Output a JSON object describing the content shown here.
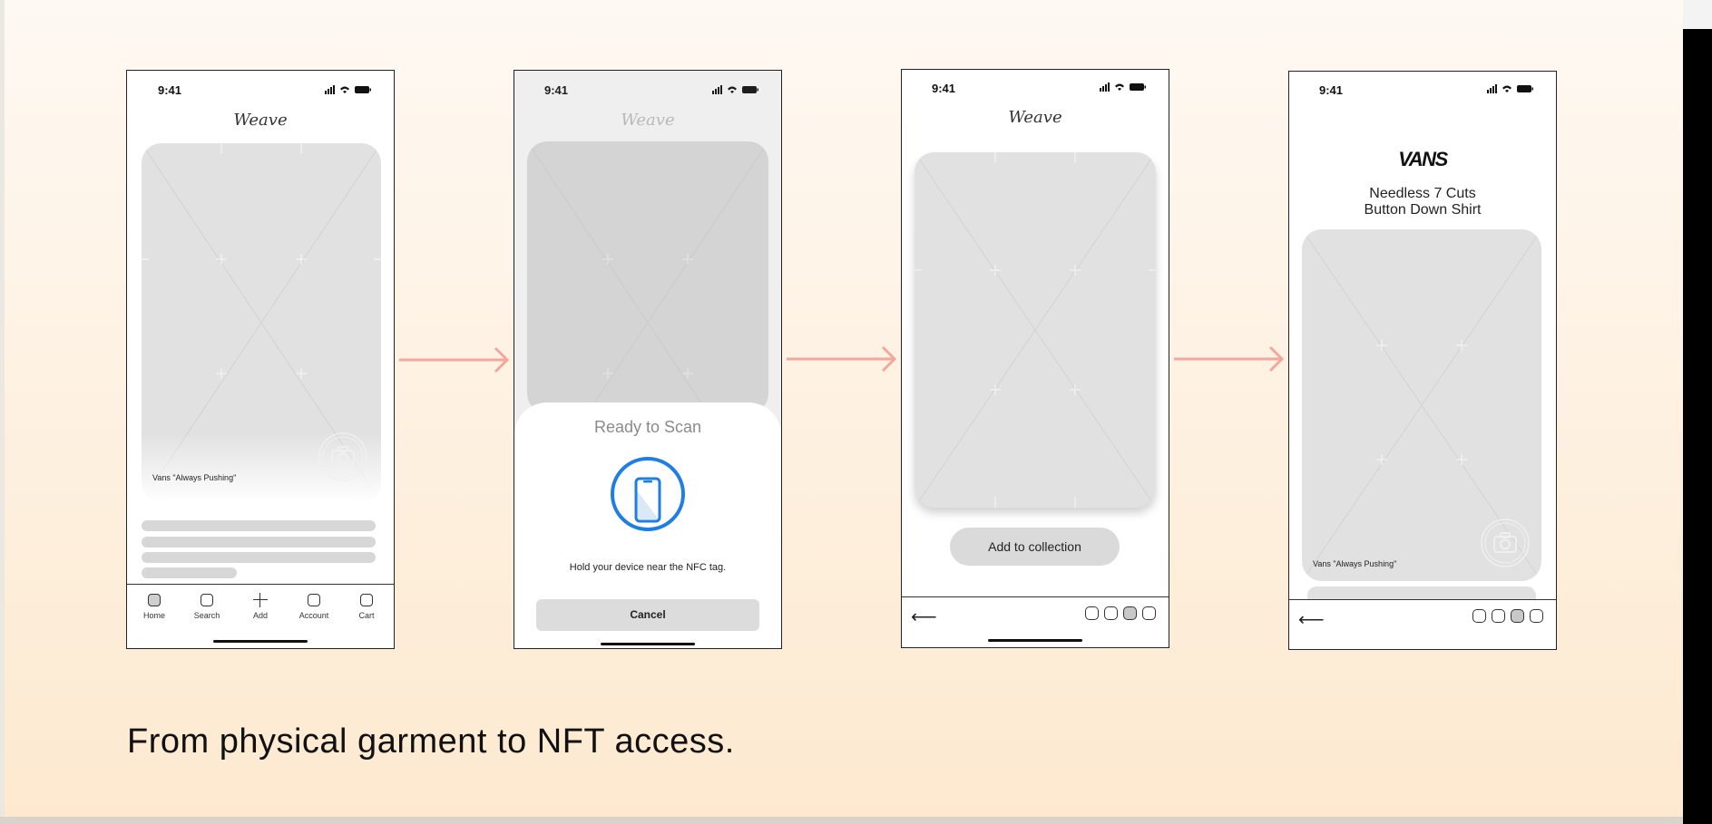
{
  "status_time": "9:41",
  "brand": "Weave",
  "screen1": {
    "card_caption": "Vans \"Always Pushing\"",
    "tabs": [
      {
        "label": "Home"
      },
      {
        "label": "Search"
      },
      {
        "label": "Add"
      },
      {
        "label": "Account"
      },
      {
        "label": "Cart"
      }
    ]
  },
  "screen2": {
    "sheet_title": "Ready to Scan",
    "message": "Hold your device near the NFC tag.",
    "cancel_label": "Cancel"
  },
  "screen3": {
    "add_label": "Add to collection",
    "back_icon": "⟵",
    "active_step": 3
  },
  "screen4": {
    "logo_text": "VANS",
    "product_line1": "Needless 7 Cuts",
    "product_line2": "Button Down Shirt",
    "card_caption": "Vans \"Always Pushing\"",
    "back_icon": "⟵",
    "active_step": 3
  },
  "caption": "From physical garment to NFT access.",
  "colors": {
    "arrow": "#f4a79c",
    "nfc_blue": "#1e7ee4",
    "placeholder": "#e1e1e1"
  }
}
